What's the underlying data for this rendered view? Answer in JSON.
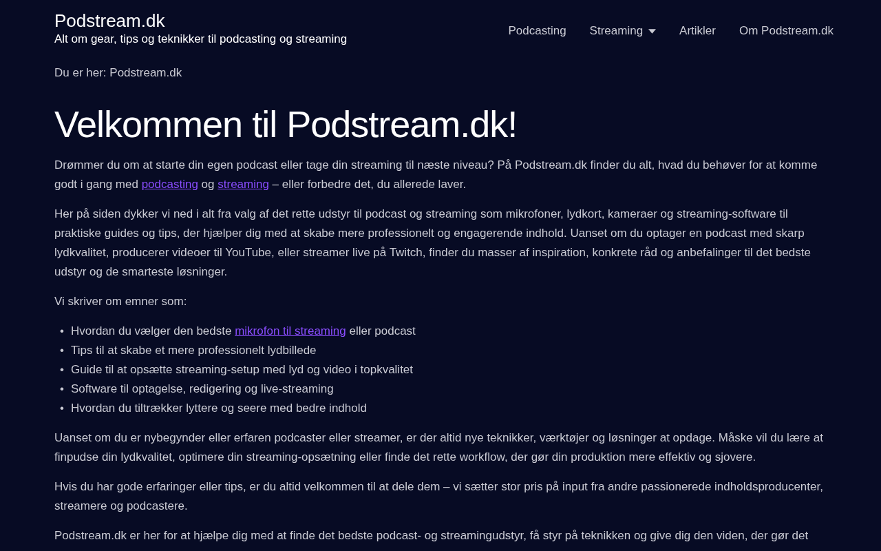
{
  "site": {
    "title": "Podstream.dk",
    "tagline": "Alt om gear, tips og teknikker til podcasting og streaming"
  },
  "nav": [
    {
      "label": "Podcasting",
      "dropdown": false
    },
    {
      "label": "Streaming",
      "dropdown": true
    },
    {
      "label": "Artikler",
      "dropdown": false
    },
    {
      "label": "Om Podstream.dk",
      "dropdown": false
    }
  ],
  "breadcrumb": "Du er her: Podstream.dk",
  "heading": "Velkommen til Podstream.dk!",
  "content": [
    {
      "kind": "paragraph",
      "parts": [
        {
          "text": "Drømmer du om at starte din egen podcast eller tage din streaming til næste niveau? På Podstream.dk finder du alt, hvad du behøver for at komme godt i gang med "
        },
        {
          "text": "podcasting",
          "link": true
        },
        {
          "text": " og "
        },
        {
          "text": "streaming",
          "link": true
        },
        {
          "text": " – eller forbedre det, du allerede laver."
        }
      ]
    },
    {
      "kind": "paragraph",
      "parts": [
        {
          "text": "Her på siden dykker vi ned i alt fra valg af det rette udstyr til podcast og streaming som mikrofoner, lydkort, kameraer og streaming-software til praktiske guides og tips, der hjælper dig med at skabe mere professionelt og engagerende indhold. Uanset om du optager en podcast med skarp lydkvalitet, producerer videoer til YouTube, eller streamer live på Twitch, finder du masser af inspiration, konkrete råd og anbefalinger til det bedste udstyr og de smarteste løsninger."
        }
      ]
    },
    {
      "kind": "paragraph",
      "parts": [
        {
          "text": "Vi skriver om emner som:"
        }
      ]
    },
    {
      "kind": "list",
      "marker": "•",
      "items": [
        [
          {
            "text": "Hvordan du vælger den bedste "
          },
          {
            "text": "mikrofon til streaming",
            "link": true
          },
          {
            "text": " eller podcast"
          }
        ],
        [
          {
            "text": "Tips til at skabe et mere professionelt lydbillede"
          }
        ],
        [
          {
            "text": "Guide til at opsætte streaming-setup med lyd og video i topkvalitet"
          }
        ],
        [
          {
            "text": "Software til optagelse, redigering og live-streaming"
          }
        ],
        [
          {
            "text": "Hvordan du tiltrækker lyttere og seere med bedre indhold"
          }
        ]
      ]
    },
    {
      "kind": "paragraph",
      "parts": [
        {
          "text": "Uanset om du er nybegynder eller erfaren podcaster eller streamer, er der altid nye teknikker, værktøjer og løsninger at opdage. Måske vil du lære at finpudse din lydkvalitet, optimere din streaming-opsætning eller finde det rette workflow, der gør din produktion mere effektiv og sjovere."
        }
      ]
    },
    {
      "kind": "paragraph",
      "parts": [
        {
          "text": "Hvis du har gode erfaringer eller tips, er du altid velkommen til at dele dem – vi sætter stor pris på input fra andre passionerede indholdsproducenter, streamere og podcastere."
        }
      ]
    },
    {
      "kind": "paragraph",
      "parts": [
        {
          "text": "Podstream.dk er her for at hjælpe dig med at finde det bedste podcast- og streamingudstyr, få styr på teknikken og give dig den viden, der gør det"
        }
      ]
    }
  ]
}
